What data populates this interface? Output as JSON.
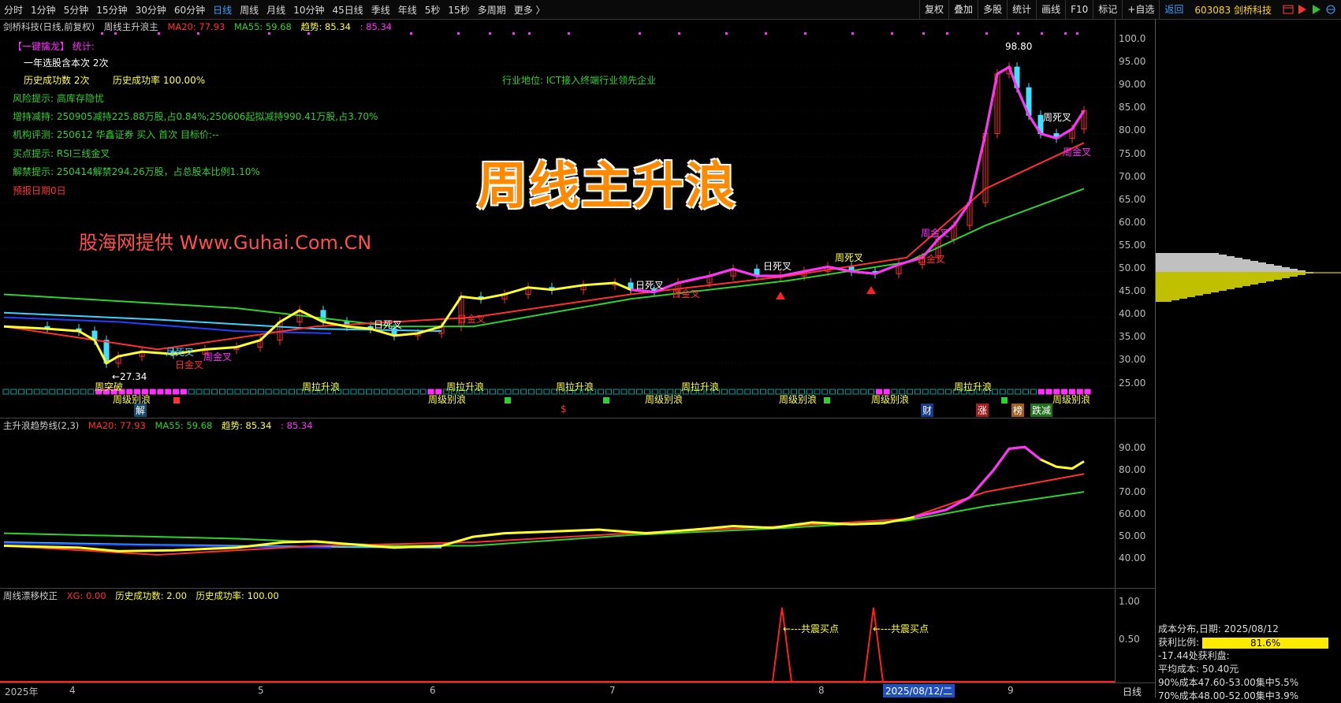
{
  "toolbar": {
    "periods": [
      "分时",
      "1分钟",
      "5分钟",
      "15分钟",
      "30分钟",
      "60分钟",
      "日线",
      "周线",
      "月线",
      "10分钟",
      "45日线",
      "季线",
      "年线",
      "5秒",
      "15秒",
      "多周期",
      "更多 〉"
    ],
    "active_period": "日线",
    "right_buttons": [
      "复权",
      "叠加",
      "多股",
      "统计",
      "画线",
      "F10",
      "标记",
      "+自选"
    ],
    "back_label": "返回",
    "stock": "603083 剑桥科技"
  },
  "main_panel": {
    "title": "剑桥科技(日线,前复权)",
    "indicator": "周线主升浪主",
    "ma20": "MA20: 77.93",
    "ma55": "MA55: 59.68",
    "trend": "趋势: 85.34",
    "trend2": ": 85.34",
    "y_ticks": [
      "100.0",
      "95.00",
      "90.00",
      "85.00",
      "80.00",
      "75.00",
      "70.00",
      "65.00",
      "60.00",
      "55.00",
      "50.00",
      "45.00",
      "40.00",
      "35.00",
      "30.00",
      "25.00"
    ],
    "high_label": "98.80",
    "low_label": "←27.34"
  },
  "info": {
    "yijian": "【一键擒龙】",
    "stat": "统计:",
    "select_count": "一年选股含本次 2次",
    "success_count": "历史成功数 2次",
    "success_rate": "历史成功率 100.00%",
    "industry": "行业地位: ICT接入终端行业领先企业",
    "risk": "风险提示: 高库存隐忧",
    "reduce": "增持减持: 250905减持225.88万股,占0.84%;250606起拟减持990.41万股,占3.70%",
    "rating": "机构评测: 250612 华鑫证券 买入 首次 目标价:--",
    "buy": "买点提示: RSI三线金叉",
    "unlock": "解禁提示: 250414解禁294.26万股，占总股本比例1.10%",
    "report": "预报日期0日"
  },
  "big_title": "周线主升浪",
  "watermark": "股海网提供 Www.Guhai.Com.CN",
  "marks": {
    "m1": "周突破",
    "m2": "周级别浪",
    "m3": "月死叉",
    "m4": "日金叉",
    "m5": "周金叉",
    "m6": "周拉升浪",
    "m7": "日死叉",
    "m8": "周拉升浪",
    "m9": "周级别浪",
    "m10": "日金叉",
    "m11": "周拉升浪",
    "m12": "日死叉",
    "m13": "周拉升浪",
    "m14": "周级别浪",
    "m15": "日金叉",
    "m16": "日死叉",
    "m17": "周死叉",
    "m18": "周级别浪",
    "m19": "周级别浪",
    "m20": "周金叉",
    "m21": "日金叉",
    "m22": "周拉升浪",
    "m23": "周死叉",
    "m24": "周金叉",
    "m25": "周级别浪",
    "tag_jie": "解",
    "tag_s": "$",
    "tag_cai": "财",
    "tag_zhang": "涨",
    "tag_bang": "榜",
    "tag_diejian": "跌减"
  },
  "sub1": {
    "title": "主升浪趋势线(2,3)",
    "ma20": "MA20: 77.93",
    "ma55": "MA55: 59.68",
    "trend": "趋势: 85.34",
    "trend2": ": 85.34",
    "y_ticks": [
      "90.00",
      "80.00",
      "70.00",
      "60.00",
      "50.00",
      "40.00"
    ]
  },
  "sub2": {
    "title": "周线漂移校正",
    "xg": "XG: 0.00",
    "cnt": "历史成功数: 2.00",
    "rate": "历史成功率: 100.00",
    "y_ticks": [
      "1.00",
      "0.50"
    ],
    "buy1": "←---共震买点",
    "buy2": "←---共震买点"
  },
  "xaxis": {
    "labels": [
      "2025年",
      "4",
      "5",
      "6",
      "7",
      "8",
      "9"
    ],
    "cursor_date": "2025/08/12/二",
    "period": "日线"
  },
  "cost": {
    "title": "成本分布,日期: 2025/08/12",
    "profit_label": "获利比例:",
    "profit_value": "81.6%",
    "profit_ratio": 0.816,
    "line1": "-17.44处获利盘:",
    "avg": "平均成本: 50.40元",
    "c90": "90%成本47.60-53.00集中5.5%",
    "c70": "70%成本48.00-52.00集中3.9%"
  },
  "colors": {
    "ma20": "#ff3030",
    "ma55": "#30d030",
    "trend_up": "#ff30ff",
    "trend_down": "#ffff30",
    "blue": "#2040ff",
    "cyan": "#40d0ff"
  }
}
